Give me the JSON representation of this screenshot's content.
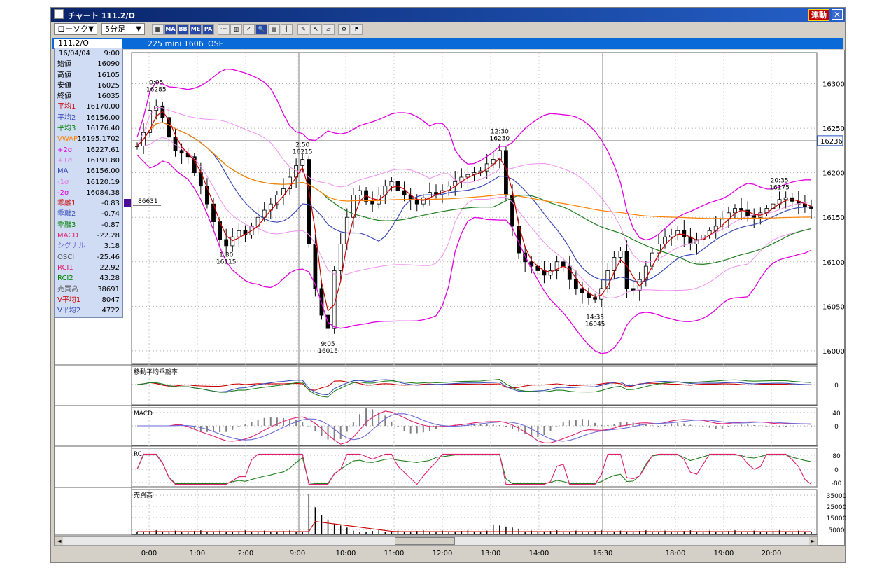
{
  "window": {
    "title": "チャート  111.2/O",
    "sync_label": "連動",
    "close_label": "✕"
  },
  "toolbar": {
    "chart_type": "ローソク",
    "interval": "5分足",
    "buttons": [
      {
        "name": "chart-settings-icon",
        "label": "▦"
      },
      {
        "name": "ma-button",
        "label": "MA"
      },
      {
        "name": "bb-button",
        "label": "BB"
      },
      {
        "name": "me-button",
        "label": "ME"
      },
      {
        "name": "pa-button",
        "label": "PA"
      },
      {
        "name": "line-icon",
        "label": "〰"
      },
      {
        "name": "candle-icon",
        "label": "▥"
      },
      {
        "name": "tick-icon",
        "label": "✓"
      },
      {
        "name": "zoom-icon",
        "label": "🔍"
      },
      {
        "name": "grid-icon",
        "label": "▤"
      },
      {
        "name": "bars-icon",
        "label": "┤"
      },
      {
        "name": "pen-icon",
        "label": "✎"
      },
      {
        "name": "pointer-icon",
        "label": "↖"
      },
      {
        "name": "eraser-icon",
        "label": "▱"
      },
      {
        "name": "settings-icon",
        "label": "⚙"
      },
      {
        "name": "flag-icon",
        "label": "⚑"
      }
    ]
  },
  "symbol_bar": {
    "symbol": "111.2/O",
    "product": "225 mini 1606",
    "exchange": "OSE"
  },
  "info_panel": {
    "date": "16/04/04",
    "time": "9:00",
    "rows": [
      {
        "k": "始値",
        "v": "16090",
        "c": "#000000"
      },
      {
        "k": "高値",
        "v": "16105",
        "c": "#000000"
      },
      {
        "k": "安値",
        "v": "16025",
        "c": "#000000"
      },
      {
        "k": "終値",
        "v": "16035",
        "c": "#000000"
      },
      {
        "k": "平均1",
        "v": "16170.00",
        "c": "#cc0000"
      },
      {
        "k": "平均2",
        "v": "16156.00",
        "c": "#3a4ab8"
      },
      {
        "k": "平均3",
        "v": "16176.40",
        "c": "#008000"
      },
      {
        "k": "VWAP",
        "v": "16195.1702",
        "c": "#ff8000"
      },
      {
        "k": "+2σ",
        "v": "16227.61",
        "c": "#e000e0"
      },
      {
        "k": "+1σ",
        "v": "16191.80",
        "c": "#e070e0"
      },
      {
        "k": "MA",
        "v": "16156.00",
        "c": "#3a4ab8"
      },
      {
        "k": "-1σ",
        "v": "16120.19",
        "c": "#e070e0"
      },
      {
        "k": "-2σ",
        "v": "16084.38",
        "c": "#e000e0"
      },
      {
        "k": "乖離1",
        "v": "-0.83",
        "c": "#cc0000"
      },
      {
        "k": "乖離2",
        "v": "-0.74",
        "c": "#3a4ab8"
      },
      {
        "k": "乖離3",
        "v": "-0.87",
        "c": "#008000"
      },
      {
        "k": "MACD",
        "v": "-22.28",
        "c": "#e0206f"
      },
      {
        "k": "シグナル",
        "v": "3.18",
        "c": "#6a6ad8"
      },
      {
        "k": "OSCI",
        "v": "-25.46",
        "c": "#555555"
      },
      {
        "k": "RCI1",
        "v": "22.92",
        "c": "#e0206f"
      },
      {
        "k": "RCI2",
        "v": "43.28",
        "c": "#008000"
      },
      {
        "k": "売買高",
        "v": "38691",
        "c": "#555555"
      },
      {
        "k": "V平均1",
        "v": "8047",
        "c": "#cc0000"
      },
      {
        "k": "V平均2",
        "v": "4722",
        "c": "#3a4ab8"
      }
    ]
  },
  "price_chart": {
    "y_ticks": [
      "16300",
      "16250",
      "16200",
      "16150",
      "16100",
      "16050",
      "16000"
    ],
    "current_price": "16236",
    "volume_marker": "86631",
    "annotations": [
      {
        "time": "0:05",
        "price": "16285"
      },
      {
        "time": "1:30",
        "price": "16115"
      },
      {
        "time": "2:50",
        "price": "16215"
      },
      {
        "time": "9:05",
        "price": "16015"
      },
      {
        "time": "12:30",
        "price": "16230"
      },
      {
        "time": "14:35",
        "price": "16045"
      },
      {
        "time": "20:35",
        "price": "16175"
      }
    ]
  },
  "sub_panels": {
    "deviation": {
      "title": "移動平均乖離率",
      "y_ticks": [
        "0"
      ]
    },
    "macd": {
      "title": "MACD",
      "y_ticks": [
        "40",
        "0"
      ]
    },
    "rci": {
      "title": "RCI",
      "y_ticks": [
        "80",
        "0",
        "-80"
      ]
    },
    "volume": {
      "title": "売買高",
      "y_ticks": [
        "35000",
        "25000",
        "15000",
        "5000"
      ]
    }
  },
  "x_axis": {
    "labels": [
      "0:00",
      "1:00",
      "2:00",
      "9:00",
      "10:00",
      "11:00",
      "12:00",
      "13:00",
      "14:00",
      "16:30",
      "18:00",
      "19:00",
      "20:00"
    ]
  },
  "chart_data": {
    "type": "candlestick",
    "close_series": [
      16230,
      16245,
      16270,
      16275,
      16262,
      16240,
      16225,
      16222,
      16218,
      16200,
      16185,
      16165,
      16145,
      16125,
      16118,
      16128,
      16135,
      16130,
      16140,
      16150,
      16158,
      16165,
      16175,
      16182,
      16195,
      16208,
      16215,
      16120,
      16070,
      16040,
      16025,
      16090,
      16120,
      16150,
      16175,
      16180,
      16168,
      16165,
      16175,
      16185,
      16190,
      16180,
      16175,
      16170,
      16165,
      16172,
      16178,
      16176,
      16180,
      16185,
      16190,
      16195,
      16198,
      16200,
      16202,
      16210,
      16215,
      16225,
      16175,
      16140,
      16110,
      16100,
      16095,
      16090,
      16085,
      16090,
      16100,
      16095,
      16080,
      16070,
      16065,
      16060,
      16058,
      16070,
      16090,
      16105,
      16112,
      16070,
      16068,
      16080,
      16095,
      16110,
      16120,
      16128,
      16130,
      16135,
      16128,
      16120,
      16125,
      16130,
      16135,
      16140,
      16148,
      16155,
      16160,
      16158,
      16152,
      16150,
      16155,
      16160,
      16165,
      16170,
      16172,
      16168,
      16165,
      16162,
      16160
    ],
    "ylim": [
      15985,
      16335
    ]
  }
}
